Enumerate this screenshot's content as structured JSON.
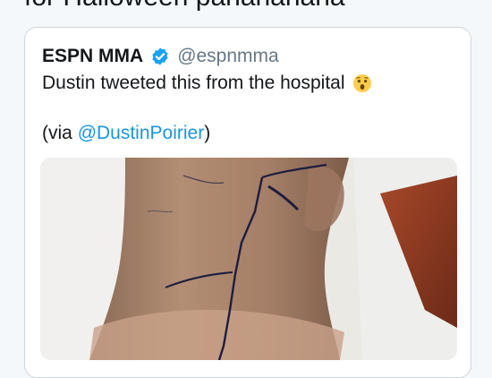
{
  "top_line": "for Halloween pahahahaha",
  "quoted_tweet": {
    "author_name": "ESPN MMA",
    "handle": "@espnmma",
    "text": "Dustin tweeted this from the hospital",
    "emoji_icon": "astonished-face-icon",
    "via_prefix": "(via ",
    "via_mention": "@DustinPoirier",
    "via_suffix": ")"
  },
  "colors": {
    "link": "#1b95e0",
    "verified": "#1da1f2",
    "text": "#14171a",
    "secondary": "#657786",
    "border": "#ccd6dd"
  }
}
